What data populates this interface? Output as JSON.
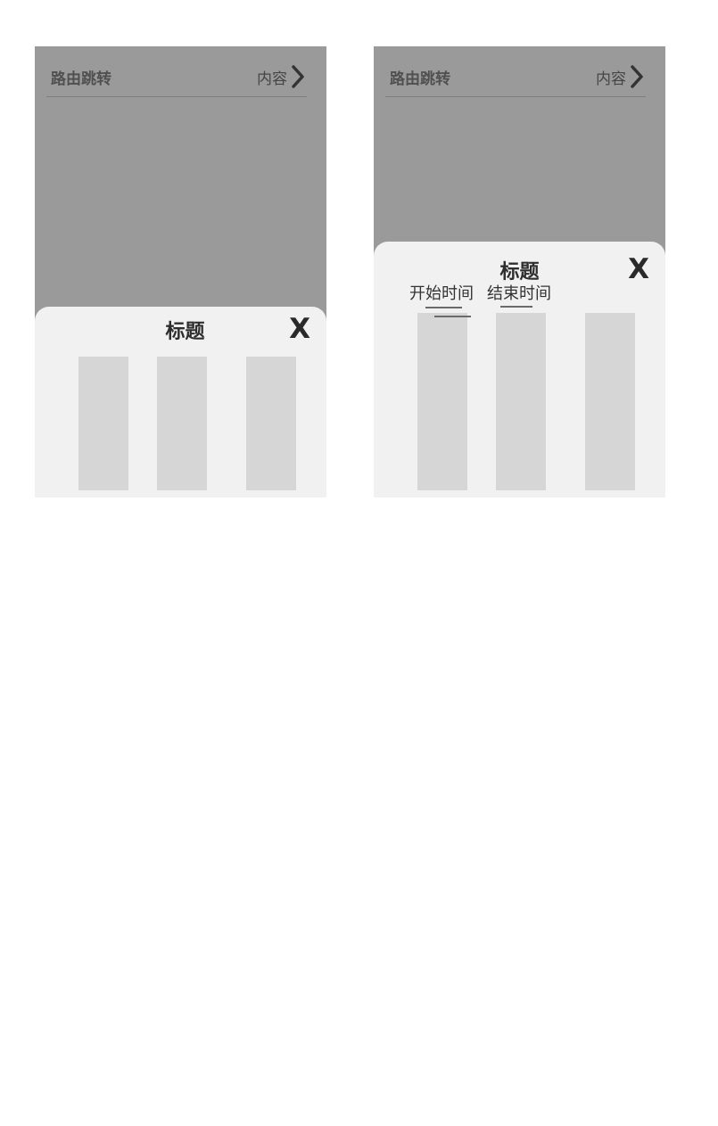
{
  "screens": [
    {
      "route": {
        "label": "路由跳转",
        "value": "内容"
      },
      "sheet": {
        "title": "标题",
        "close_label": "X"
      }
    },
    {
      "route": {
        "label": "路由跳转",
        "value": "内容"
      },
      "sheet": {
        "title": "标题",
        "close_label": "X",
        "start_time_label": "开始时间",
        "end_time_label": "结束时间"
      }
    }
  ]
}
